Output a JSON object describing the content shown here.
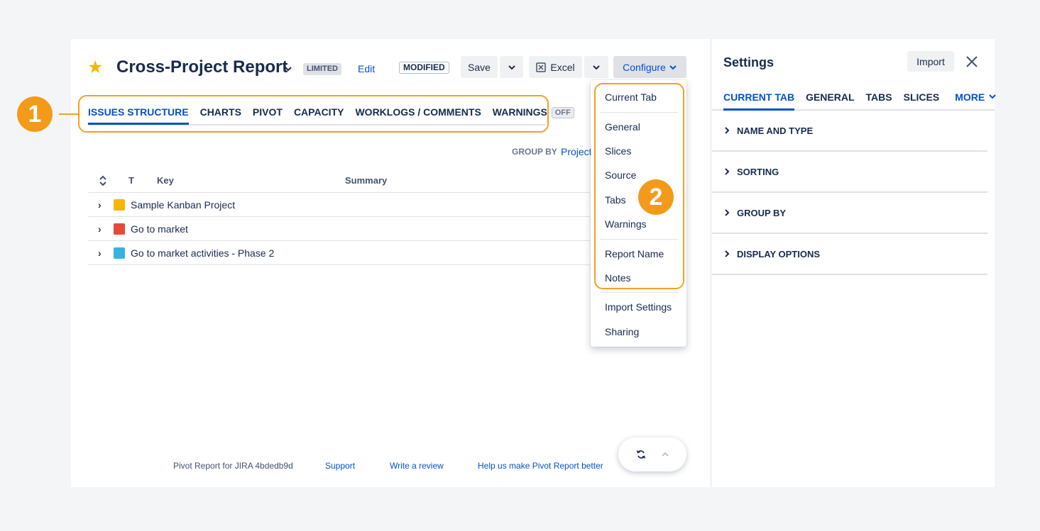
{
  "report": {
    "title": "Cross-Project Report",
    "limited_badge": "LIMITED",
    "edit_link": "Edit",
    "modified_badge": "MODIFIED"
  },
  "toolbar": {
    "save_label": "Save",
    "excel_label": "Excel",
    "configure_label": "Configure"
  },
  "tabs": [
    {
      "label": "ISSUES STRUCTURE",
      "active": true
    },
    {
      "label": "CHARTS"
    },
    {
      "label": "PIVOT"
    },
    {
      "label": "CAPACITY"
    },
    {
      "label": "WORKLOGS / COMMENTS"
    },
    {
      "label": "WARNINGS",
      "badge": "OFF"
    }
  ],
  "group_by": {
    "label": "GROUP BY",
    "value": "Project"
  },
  "table": {
    "headers": {
      "type": "T",
      "key": "Key",
      "summary": "Summary"
    },
    "rows": [
      {
        "key": "Sample Kanban Project",
        "icon": "project-icon",
        "color": "#f5b700"
      },
      {
        "key": "Go to market",
        "icon": "project-icon",
        "color": "#e5493a"
      },
      {
        "key": "Go to market activities - Phase 2",
        "icon": "project-icon",
        "color": "#36b3e0"
      }
    ]
  },
  "configure_menu": {
    "items": [
      "Current Tab",
      "General",
      "Slices",
      "Source",
      "Tabs",
      "Warnings",
      "Report Name",
      "Notes",
      "Import Settings",
      "Sharing"
    ]
  },
  "annotations": {
    "one": "1",
    "two": "2"
  },
  "footer": {
    "version": "Pivot Report for JIRA 4bdedb9d",
    "support": "Support",
    "review": "Write a review",
    "help": "Help us make Pivot Report better"
  },
  "settings": {
    "title": "Settings",
    "import_label": "Import",
    "tabs": [
      "CURRENT TAB",
      "GENERAL",
      "TABS",
      "SLICES"
    ],
    "more_label": "MORE",
    "sections": [
      "NAME AND TYPE",
      "SORTING",
      "GROUP BY",
      "DISPLAY OPTIONS"
    ]
  },
  "colors": {
    "accent": "#0052cc",
    "annotation": "#f49a1a",
    "star": "#f5b700"
  }
}
